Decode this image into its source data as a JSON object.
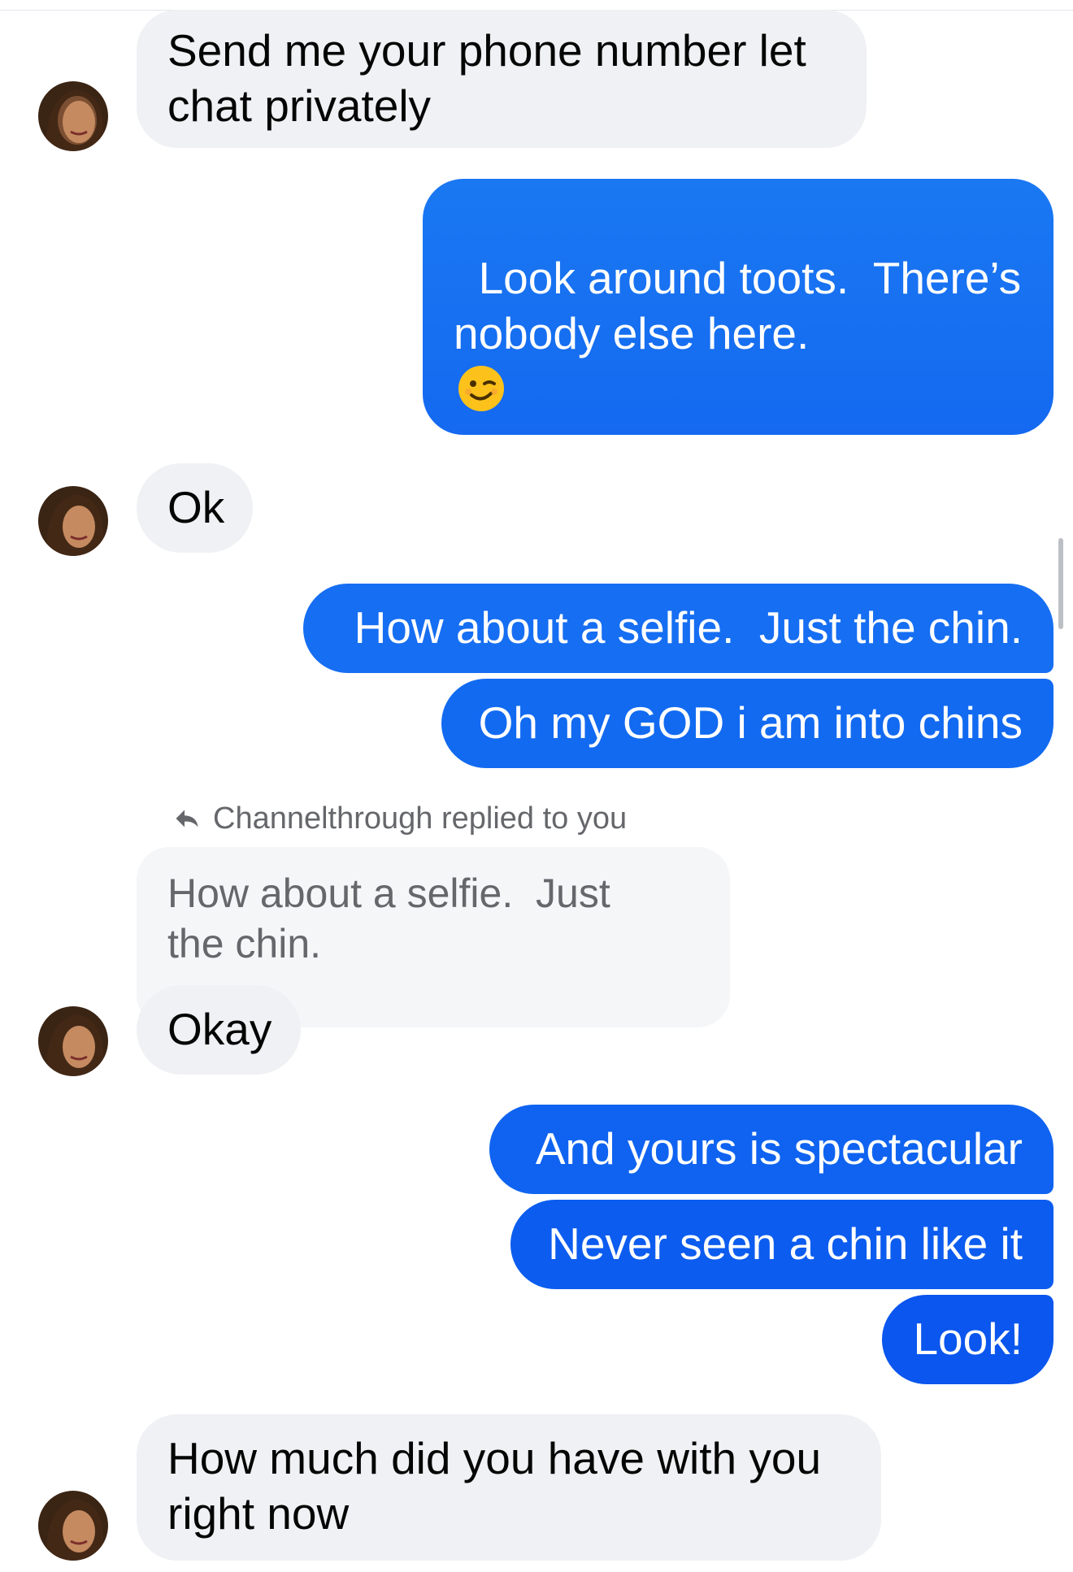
{
  "conversation": {
    "messages": [
      {
        "id": "m1",
        "from": "them",
        "text": "Send me your phone number let\nchat privately"
      },
      {
        "id": "m2",
        "from": "me",
        "text": "Look around toots.  There’s\nnobody else here.",
        "emoji": "winking-face"
      },
      {
        "id": "m3",
        "from": "them",
        "text": "Ok"
      },
      {
        "id": "m4",
        "from": "me",
        "text": "How about a selfie.  Just the chin."
      },
      {
        "id": "m5",
        "from": "me",
        "text": "Oh my GOD i am into chins"
      },
      {
        "id": "m6",
        "from": "them",
        "text": "Okay"
      },
      {
        "id": "m7",
        "from": "me",
        "text": "And yours is spectacular"
      },
      {
        "id": "m8",
        "from": "me",
        "text": "Never seen a chin like it"
      },
      {
        "id": "m9",
        "from": "me",
        "text": "Look!"
      },
      {
        "id": "m10",
        "from": "them",
        "text": "How much did you have with you\nright now"
      }
    ],
    "reply_indicator": {
      "icon": "reply-arrow-icon",
      "text": "Channelthrough replied to you",
      "quoted_text": "How about a selfie.  Just\nthe chin."
    }
  },
  "colors": {
    "incoming_bubble": "#f0f1f4",
    "outgoing_gradient_top": "#1877f2",
    "outgoing_gradient_bottom": "#0a53e6",
    "secondary_text": "#65676b"
  }
}
